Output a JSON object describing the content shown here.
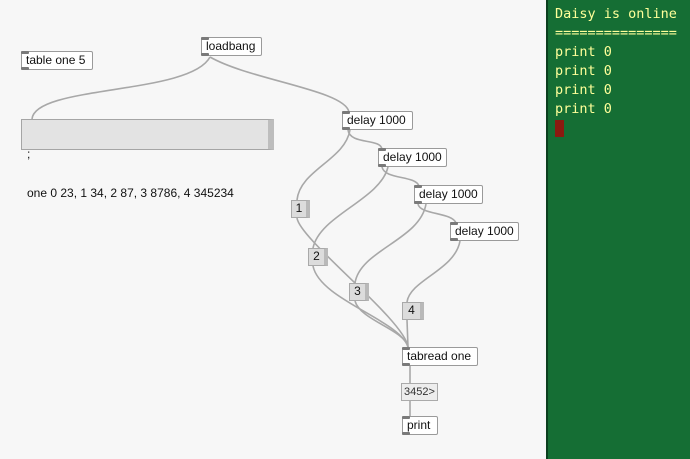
{
  "patch": {
    "table_obj": "table one 5",
    "loadbang": "loadbang",
    "message_line1": ";",
    "message_line2": "one 0 23, 1 34, 2 87, 3 8786, 4 345234",
    "delays": [
      "delay 1000",
      "delay 1000",
      "delay 1000",
      "delay 1000"
    ],
    "numbers": [
      "1",
      "2",
      "3",
      "4"
    ],
    "tabread": "tabread one",
    "atom_value": "3452>",
    "print": "print"
  },
  "console": {
    "lines": [
      "Daisy is online",
      "===============",
      "print 0",
      "print 0",
      "print 0",
      "print 0"
    ],
    "colors": {
      "background": "#156e34",
      "text": "#ffff9a",
      "cursor": "#8b1a10"
    }
  },
  "colors": {
    "canvas": "#f7f7f7",
    "wire": "#a8a8a8"
  }
}
